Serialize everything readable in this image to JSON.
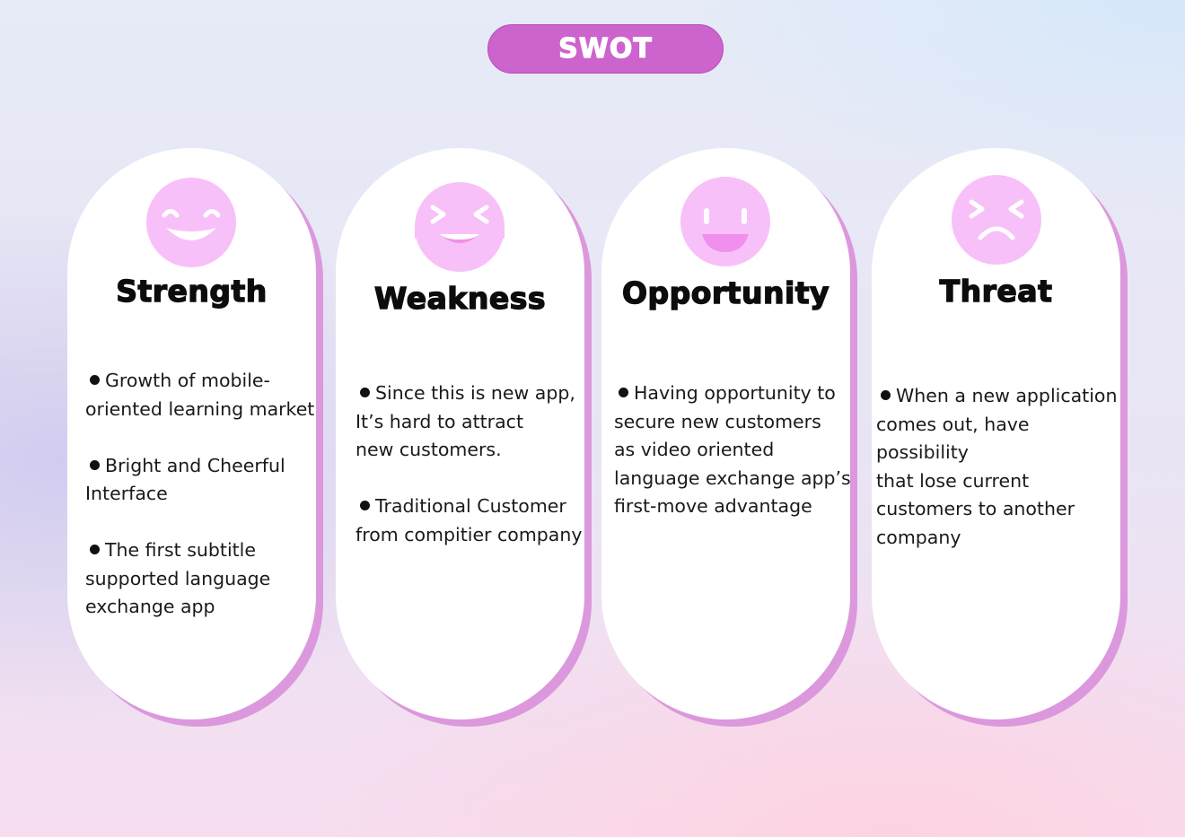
{
  "title": "SWOT",
  "colors": {
    "pill": "#cd63cd",
    "card_shadow": "#dc98dc",
    "face": "#f8c0f8",
    "face_features": "#ffffff"
  },
  "cards": [
    {
      "title": "Strength",
      "icon": "happy-face-icon",
      "points": [
        "Growth of mobile-\noriented learning market",
        "Bright and Cheerful\nInterface",
        "The first subtitle\nsupported language\nexchange app"
      ]
    },
    {
      "title": "Weakness",
      "icon": "laughing-tears-face-icon",
      "points": [
        "Since this is new app,\nIt’s hard to attract\nnew customers.",
        "Traditional Customer\nfrom compitier company"
      ]
    },
    {
      "title": "Opportunity",
      "icon": "smiling-face-icon",
      "points": [
        "Having opportunity to\nsecure new customers\nas video oriented\nlanguage exchange app’s\nfirst-move advantage"
      ]
    },
    {
      "title": "Threat",
      "icon": "frowning-face-icon",
      "points": [
        "When a new application\ncomes out, have possibility\nthat lose current\ncustomers to another\ncompany"
      ]
    }
  ]
}
